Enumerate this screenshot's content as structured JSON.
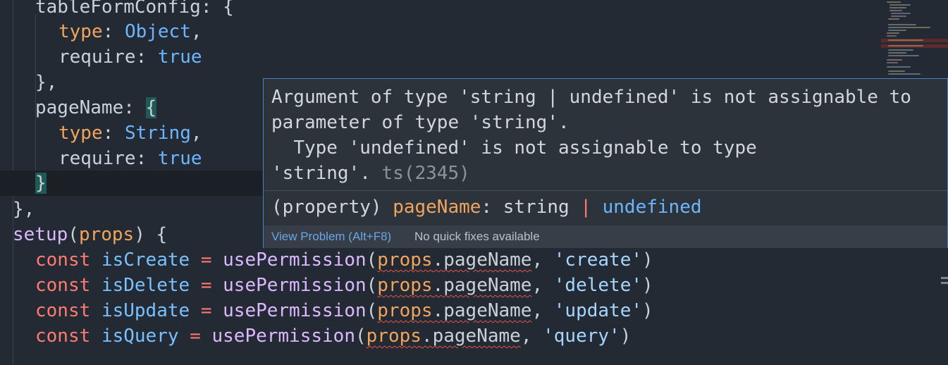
{
  "code": {
    "l1": {
      "key": "tableFormConfig",
      "rest": ": {"
    },
    "l2": {
      "prop": "type",
      "colon": ": ",
      "val": "Object",
      "comma": ","
    },
    "l3": {
      "prop": "require",
      "colon": ": ",
      "val": "true"
    },
    "l4": {
      "text": "},"
    },
    "l5": {
      "key": "pageName",
      "colon": ": ",
      "brace": "{"
    },
    "l6": {
      "prop": "type",
      "colon": ": ",
      "val": "String",
      "comma": ","
    },
    "l7": {
      "prop": "require",
      "colon": ": ",
      "val": "true"
    },
    "l8": {
      "brace": "}"
    },
    "l9": {
      "text": "},"
    },
    "l10": {
      "fn": "setup",
      "open": "(",
      "param": "props",
      "close": ") {"
    },
    "calls": [
      {
        "kw": "const",
        "name": "isCreate",
        "eq": " = ",
        "fn": "usePermission",
        "obj": "props",
        "prop": ".pageName",
        "str": "'create'"
      },
      {
        "kw": "const",
        "name": "isDelete",
        "eq": " = ",
        "fn": "usePermission",
        "obj": "props",
        "prop": ".pageName",
        "str": "'delete'"
      },
      {
        "kw": "const",
        "name": "isUpdate",
        "eq": " = ",
        "fn": "usePermission",
        "obj": "props",
        "prop": ".pageName",
        "str": "'update'"
      },
      {
        "kw": "const",
        "name": "isQuery",
        "eq": " = ",
        "fn": "usePermission",
        "obj": "props",
        "prop": ".pageName",
        "str": "'query'"
      }
    ]
  },
  "hover": {
    "message": "Argument of type 'string | undefined' is not assignable to\nparameter of type 'string'.\n  Type 'undefined' is not assignable to type\n'string'.",
    "code": " ts(2345)",
    "sig_prefix": "(property) ",
    "sig_name": "pageName",
    "sig_colon": ": string ",
    "sig_bar": "|",
    "sig_undefined": " undefined",
    "view_problem": "View Problem (Alt+F8)",
    "no_fixes": "No quick fixes available"
  },
  "colors": {
    "background": "#232a33",
    "hover_border": "#4a7fc1",
    "error": "#e5534b"
  }
}
